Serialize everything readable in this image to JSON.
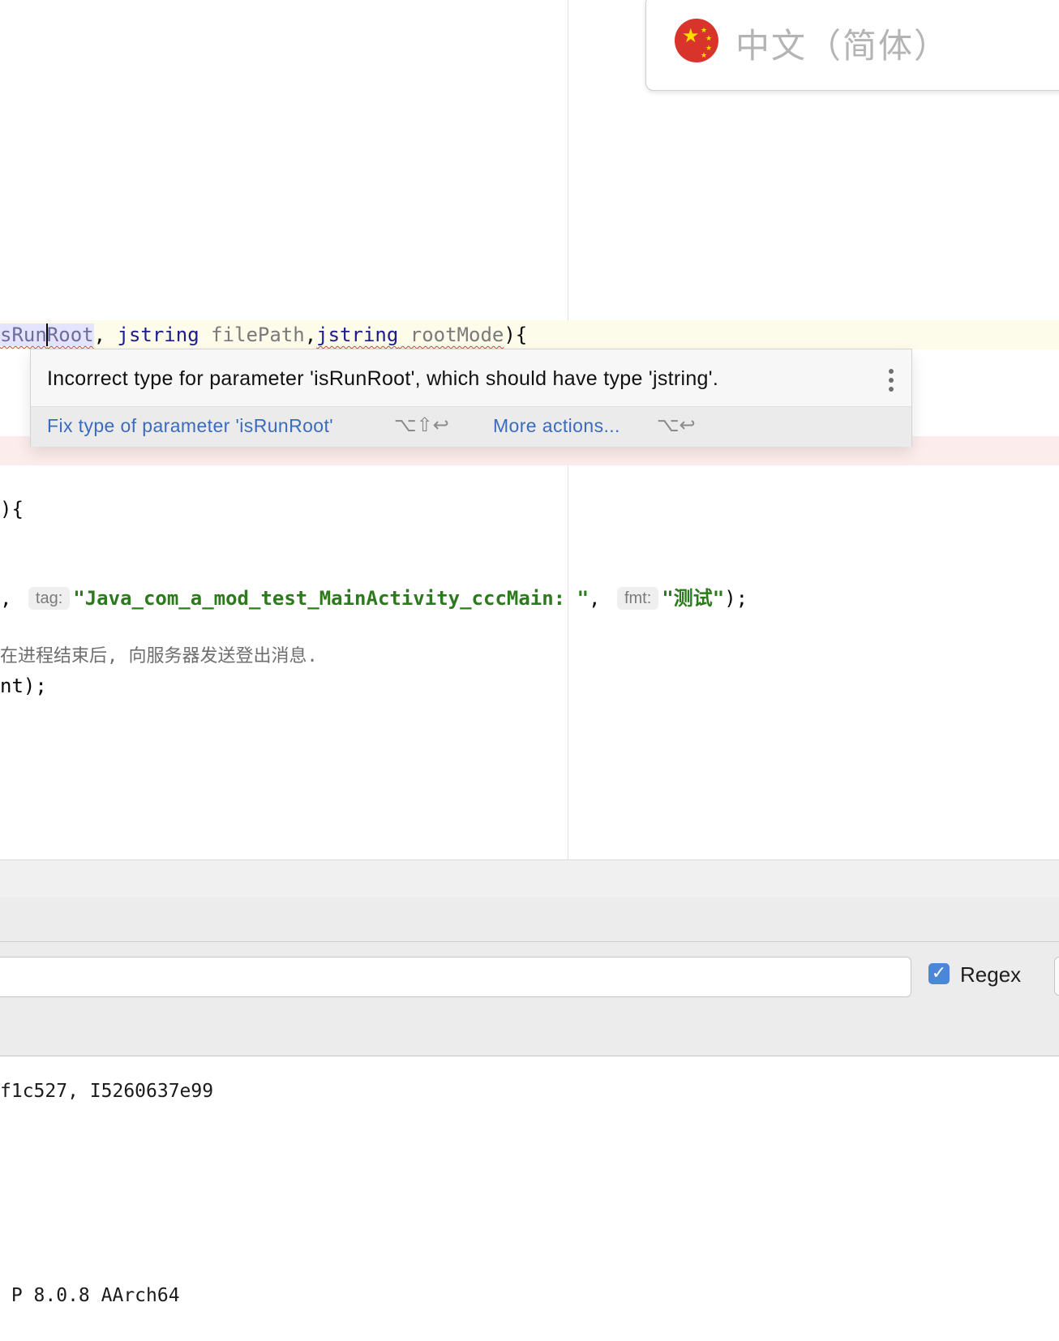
{
  "editor": {
    "line1": {
      "part_selected_a": "sRun",
      "part_selected_b": "Root",
      "comma1": ", ",
      "type1": "jstring",
      "param1": " filePath",
      "comma2": ",",
      "type2": "jstring",
      "param2": " rootMode",
      "tail": "){"
    },
    "line2": "){",
    "line3": {
      "lead": ", ",
      "tag_hint": "tag:",
      "tag_value": "\"Java_com_a_mod_test_MainActivity_cccMain: \"",
      "sep": ", ",
      "fmt_hint": "fmt:",
      "fmt_value": "\"测试\"",
      "tail": ");"
    },
    "comment": "在进程结束后, 向服务器发送登出消息.",
    "line5": "nt);"
  },
  "language_popup": {
    "label": "中文（简体）",
    "flag_icon": "china-flag-icon"
  },
  "tooltip": {
    "message": "Incorrect type for parameter 'isRunRoot', which should have type 'jstring'.",
    "fix_action": "Fix type of parameter 'isRunRoot'",
    "fix_shortcut": "⌥⇧↩",
    "more_action": "More actions...",
    "more_shortcut": "⌥↩"
  },
  "filter": {
    "value": "",
    "regex_label": "Regex",
    "regex_checked": true
  },
  "log": {
    "line1": "f1c527, I5260637e99",
    "line2": " P 8.0.8 AArch64"
  },
  "colors": {
    "link": "#3b6bbf",
    "error_underline": "#d64040",
    "string": "#2d7a1e",
    "checkbox": "#4c86d6"
  }
}
